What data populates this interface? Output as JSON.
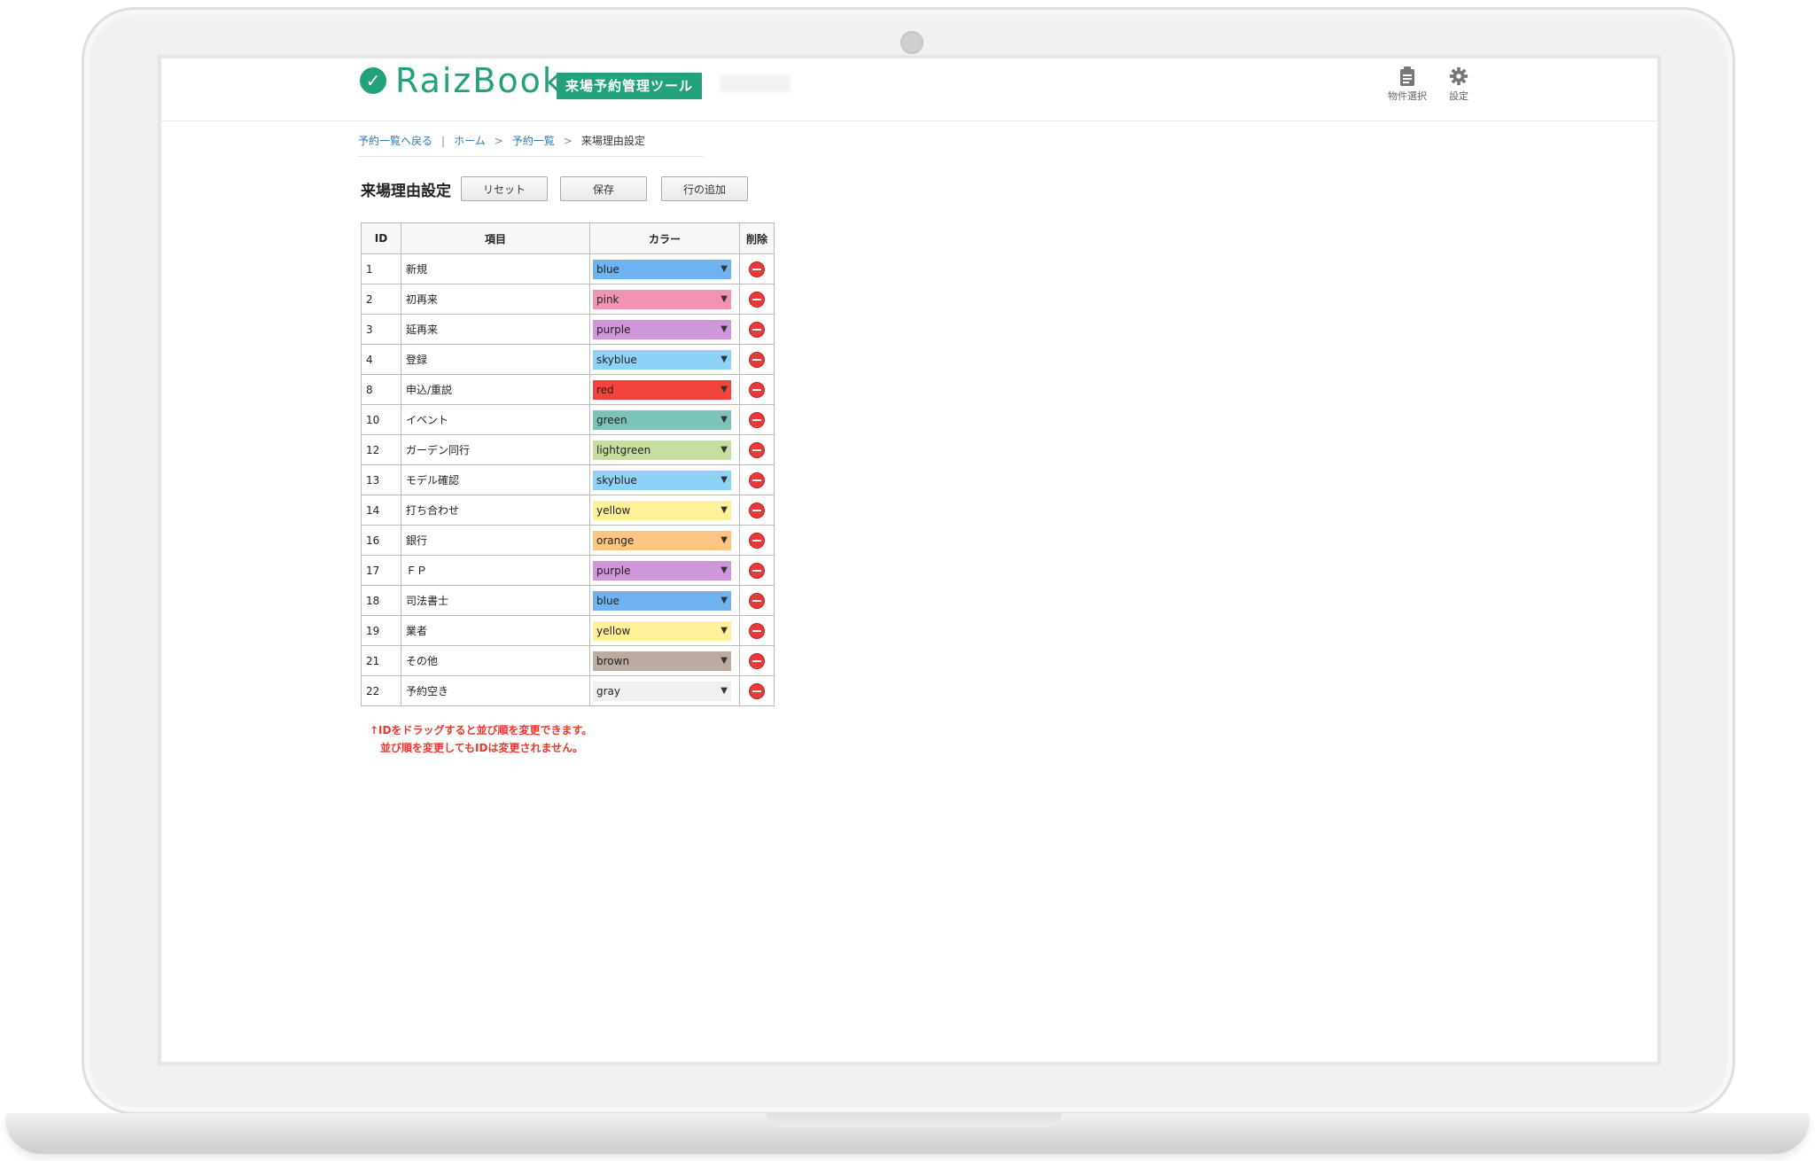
{
  "header": {
    "logo_text": "RaizBook",
    "logo_badge": "来場予約管理ツール",
    "property_select_label": "物件選択",
    "settings_label": "設定"
  },
  "breadcrumb": {
    "back": "予約一覧へ戻る",
    "home": "ホーム",
    "list": "予約一覧",
    "current": "来場理由設定"
  },
  "page": {
    "title": "来場理由設定",
    "reset_label": "リセット",
    "save_label": "保存",
    "add_row_label": "行の追加"
  },
  "table": {
    "headers": [
      "ID",
      "項目",
      "カラー",
      "削除"
    ],
    "rows": [
      {
        "id": "1",
        "name": "新規",
        "color": "blue",
        "hex": "#6fb4f0"
      },
      {
        "id": "2",
        "name": "初再来",
        "color": "pink",
        "hex": "#f393b3"
      },
      {
        "id": "3",
        "name": "延再来",
        "color": "purple",
        "hex": "#cf96da"
      },
      {
        "id": "4",
        "name": "登録",
        "color": "skyblue",
        "hex": "#8fd2f7"
      },
      {
        "id": "8",
        "name": "申込/重説",
        "color": "red",
        "hex": "#f2433d"
      },
      {
        "id": "10",
        "name": "イベント",
        "color": "green",
        "hex": "#7cc4b8"
      },
      {
        "id": "12",
        "name": "ガーデン同行",
        "color": "lightgreen",
        "hex": "#c6de9f"
      },
      {
        "id": "13",
        "name": "モデル確認",
        "color": "skyblue",
        "hex": "#8fd2f7"
      },
      {
        "id": "14",
        "name": "打ち合わせ",
        "color": "yellow",
        "hex": "#fff09a"
      },
      {
        "id": "16",
        "name": "銀行",
        "color": "orange",
        "hex": "#fcc581"
      },
      {
        "id": "17",
        "name": "ＦＰ",
        "color": "purple",
        "hex": "#cf96da"
      },
      {
        "id": "18",
        "name": "司法書士",
        "color": "blue",
        "hex": "#6fb4f0"
      },
      {
        "id": "19",
        "name": "業者",
        "color": "yellow",
        "hex": "#fff09a"
      },
      {
        "id": "21",
        "name": "その他",
        "color": "brown",
        "hex": "#bcaba1"
      },
      {
        "id": "22",
        "name": "予約空き",
        "color": "gray",
        "hex": "#f0f0f0"
      }
    ]
  },
  "note": {
    "line1": "↑IDをドラッグすると並び順を変更できます。",
    "line2": "並び順を変更してもIDは変更されません。"
  },
  "colors": {
    "brand": "#22a17a",
    "link": "#2c7bb6",
    "note": "#e53b2c",
    "delete": "#e83a3a"
  }
}
